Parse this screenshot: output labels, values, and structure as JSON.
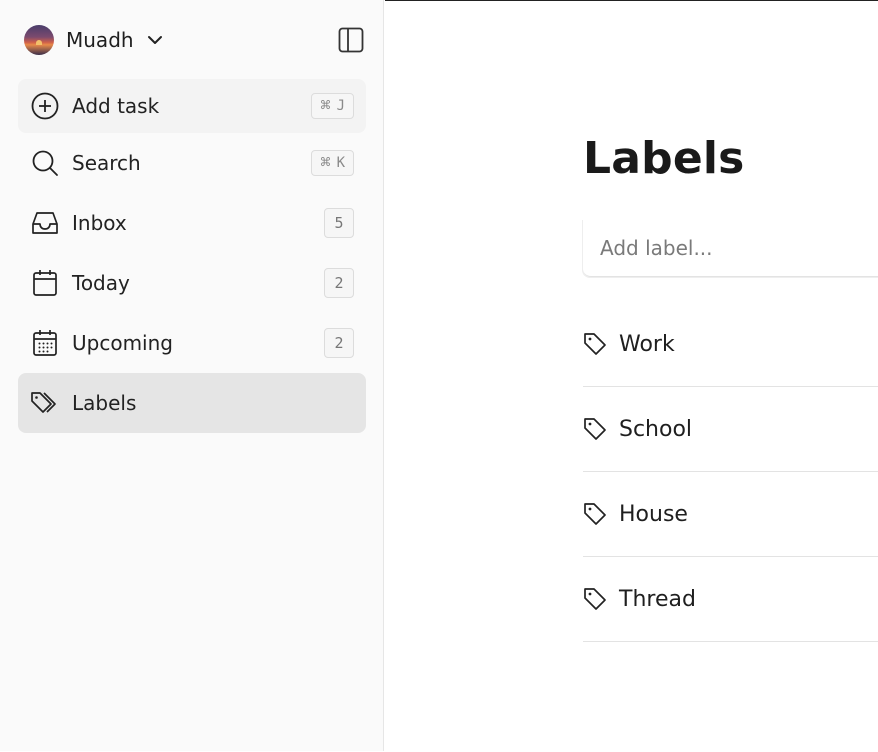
{
  "account": {
    "name": "Muadh"
  },
  "sidebar": {
    "add_task": {
      "label": "Add task",
      "shortcut_symbol": "⌘",
      "shortcut_key": "J"
    },
    "search": {
      "label": "Search",
      "shortcut_symbol": "⌘",
      "shortcut_key": "K"
    },
    "items": [
      {
        "label": "Inbox",
        "count": "5"
      },
      {
        "label": "Today",
        "count": "2"
      },
      {
        "label": "Upcoming",
        "count": "2"
      },
      {
        "label": "Labels"
      }
    ]
  },
  "main": {
    "title": "Labels",
    "add_label_placeholder": "Add label...",
    "labels": [
      {
        "name": "Work"
      },
      {
        "name": "School"
      },
      {
        "name": "House"
      },
      {
        "name": "Thread"
      }
    ]
  },
  "icons": {
    "account_chevron": "chevron-down-icon",
    "panel_toggle": "sidebar-toggle-icon",
    "add_task": "plus-circle-icon",
    "search": "search-icon",
    "inbox": "inbox-icon",
    "today": "calendar-icon",
    "upcoming": "calendar-grid-icon",
    "labels": "tags-icon",
    "label_row": "tag-icon"
  },
  "colors": {
    "sidebar_bg": "#fafafa",
    "add_task_bg": "#f3f3f3",
    "active_item_bg": "#e5e5e5",
    "text": "#1f1f1f",
    "divider": "#e3e3e3"
  }
}
